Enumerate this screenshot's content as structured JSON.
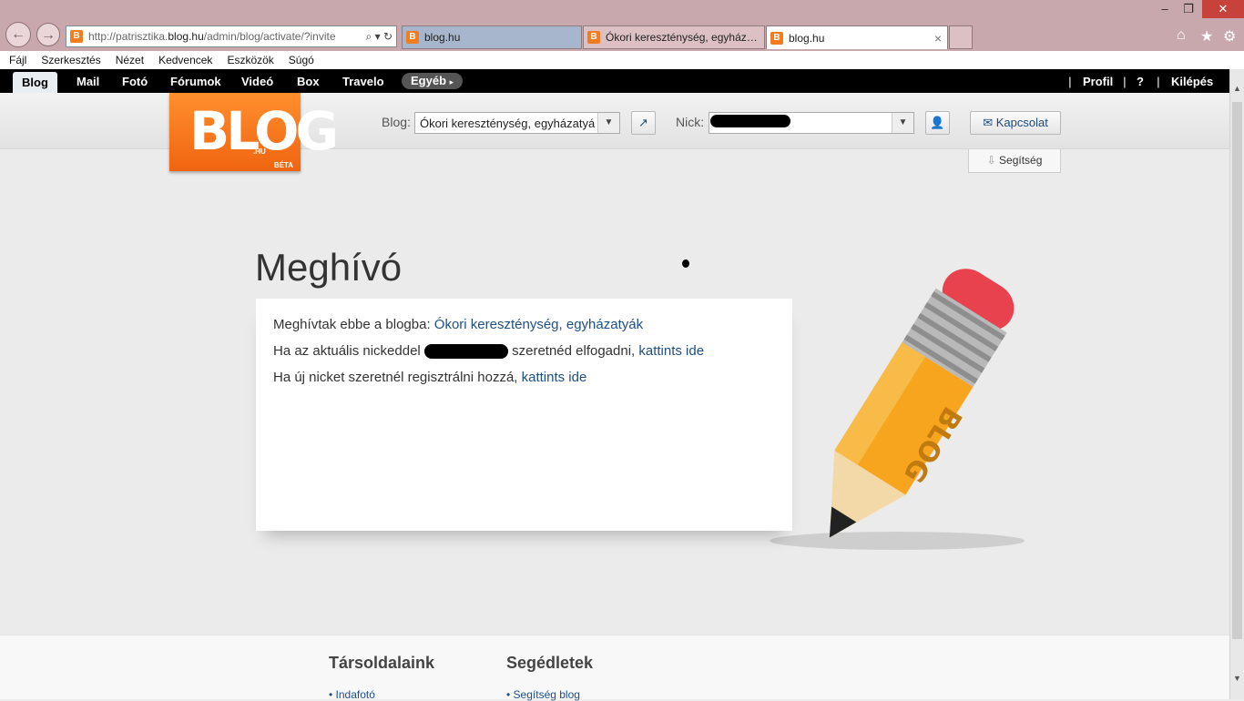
{
  "browser": {
    "address_url": "http://patrisztika.",
    "address_domain": "blog.hu",
    "address_path": "/admin/blog/activate/?invite",
    "address_icons": "⌕ ▾ ↻",
    "tabs": [
      {
        "label": "blog.hu"
      },
      {
        "label": "Ókori kereszténység, egyházat..."
      },
      {
        "label": "blog.hu"
      }
    ],
    "tab_close": "×",
    "menu": [
      "Fájl",
      "Szerkesztés",
      "Nézet",
      "Kedvencek",
      "Eszközök",
      "Súgó"
    ],
    "favicon_letter": "B"
  },
  "site_nav": {
    "items": [
      "Blog",
      "Mail",
      "Fotó",
      "Fórumok",
      "Videó",
      "Box",
      "Travelo"
    ],
    "more": "Egyéb",
    "more_arrow": "▸",
    "right": [
      "Profil",
      "?",
      "Kilépés"
    ],
    "sep": "|"
  },
  "topbar": {
    "logo_text": "BLOG",
    "logo_hu": ".HU",
    "logo_beta": "BÉTA",
    "blog_label": "Blog:",
    "blog_value": "Ókori kereszténység, egyházatyá",
    "nick_label": "Nick:",
    "contact_label": "Kapcsolat",
    "help_label": "Segítség"
  },
  "page": {
    "title": "Meghívó",
    "line1_text": "Meghívtak ebbe a blogba: ",
    "line1_link": "Ókori kereszténység, egyházatyák",
    "line2_pre": "Ha az aktuális nickeddel ",
    "line2_post": " szeretnéd elfogadni, ",
    "line2_link": "kattints ide",
    "line3_text": "Ha új nicket szeretnél regisztrálni hozzá, ",
    "line3_link": "kattints ide"
  },
  "pencil_text": "BLOG",
  "footer": {
    "col1_title": "Társoldalaink",
    "col1_item": "Indafotó",
    "col2_title": "Segédletek",
    "col2_item": "Segítség blog"
  },
  "colors": {
    "brand_orange": "#f47c20",
    "link": "#1d4f86",
    "nav_bg": "#000000"
  }
}
